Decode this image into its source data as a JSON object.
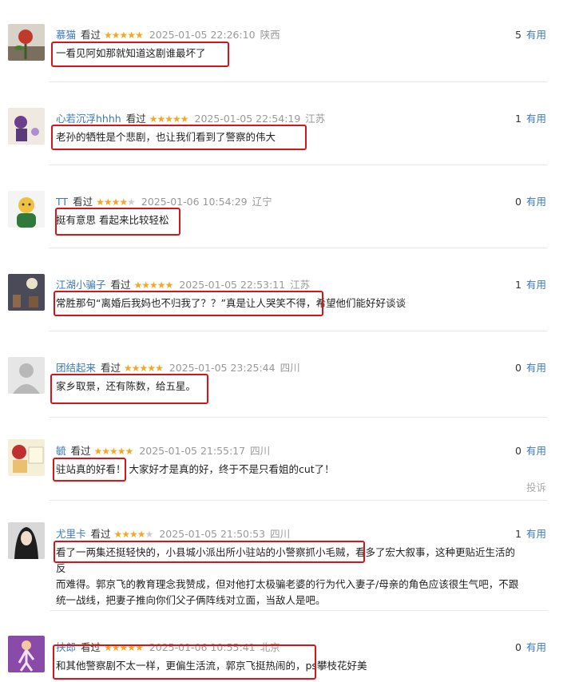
{
  "reviews": [
    {
      "user": "慕猫",
      "tag": "看过",
      "stars": 5,
      "date": "2025-01-05 22:26:10",
      "loc": "陕西",
      "useful": "5",
      "useful_label": "有用",
      "lines": [
        "一看见阿如那就知道这剧谁最坏了"
      ]
    },
    {
      "user": "心若沉浮hhhh",
      "tag": "看过",
      "stars": 5,
      "date": "2025-01-05 22:54:19",
      "loc": "江苏",
      "useful": "1",
      "useful_label": "有用",
      "lines": [
        "老孙的牺牲是个悲剧，也让我们看到了警察的伟大"
      ]
    },
    {
      "user": "TT",
      "tag": "看过",
      "stars": 4,
      "date": "2025-01-06 10:54:29",
      "loc": "辽宁",
      "useful": "0",
      "useful_label": "有用",
      "lines": [
        "挺有意思 看起来比较轻松"
      ]
    },
    {
      "user": "江湖小骗子",
      "tag": "看过",
      "stars": 5,
      "date": "2025-01-05 22:53:11",
      "loc": "江苏",
      "useful": "1",
      "useful_label": "有用",
      "lines": [
        "常胜那句“离婚后我妈也不归我了？？”真是让人哭笑不得，希望他们能好好谈谈"
      ]
    },
    {
      "user": "团结起来",
      "tag": "看过",
      "stars": 5,
      "date": "2025-01-05 23:25:44",
      "loc": "四川",
      "useful": "0",
      "useful_label": "有用",
      "lines": [
        "家乡取景，还有陈数，给五星。"
      ]
    },
    {
      "user": "毓",
      "tag": "看过",
      "stars": 5,
      "date": "2025-01-05 21:55:17",
      "loc": "四川",
      "useful": "0",
      "useful_label": "有用",
      "lines": [
        "驻站真的好看！ 大家好才是真的好，终于不是只看姐的cut了！"
      ],
      "report": "投诉"
    },
    {
      "user": "尤里卡",
      "tag": "看过",
      "stars": 4,
      "date": "2025-01-05 21:50:53",
      "loc": "四川",
      "useful": "1",
      "useful_label": "有用",
      "lines": [
        "看了一两集还挺轻快的，小县城小派出所小驻站的小警察抓小毛贼，看多了宏大叙事，这种更贴近生活的反",
        "而难得。郭京飞的教育理念我赞成，但对他打太极骗老婆的行为代入妻子/母亲的角色应该很生气吧，不跟",
        "统一战线，把妻子推向你们父子俩阵线对立面，当敌人是吧。"
      ]
    },
    {
      "user": "扶郎",
      "tag": "看过",
      "stars": 5,
      "date": "2025-01-06 10:55:41",
      "loc": "北京",
      "useful": "0",
      "useful_label": "有用",
      "lines": [
        "和其他警察剧不太一样，更偏生活流，郭京飞挺热闹的，ps攀枝花好美"
      ]
    }
  ]
}
